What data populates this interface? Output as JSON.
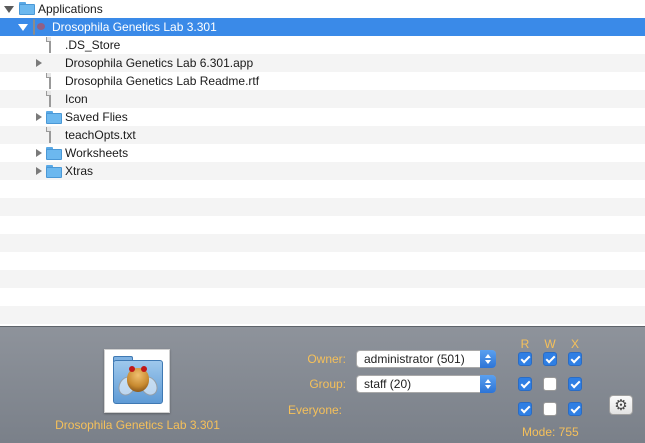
{
  "tree": {
    "root": {
      "label": "Applications",
      "icon": "folder-icon"
    },
    "selected": {
      "label": "Drosophila Genetics Lab 3.301",
      "icon": "package-icon"
    },
    "items": [
      {
        "label": ".DS_Store",
        "icon": "document-icon",
        "expandable": false
      },
      {
        "label": "Drosophila Genetics Lab 6.301.app",
        "icon": "globe-app-icon",
        "expandable": true
      },
      {
        "label": "Drosophila Genetics Lab Readme.rtf",
        "icon": "document-icon",
        "expandable": false
      },
      {
        "label": "Icon",
        "icon": "document-icon",
        "expandable": false
      },
      {
        "label": "Saved Flies",
        "icon": "folder-icon",
        "expandable": true
      },
      {
        "label": "teachOpts.txt",
        "icon": "document-icon",
        "expandable": false
      },
      {
        "label": "Worksheets",
        "icon": "folder-icon",
        "expandable": true
      },
      {
        "label": "Xtras",
        "icon": "folder-icon",
        "expandable": true
      }
    ]
  },
  "info": {
    "name": "Drosophila Genetics Lab 3.301",
    "owner_label": "Owner:",
    "owner_value": "administrator (501)",
    "group_label": "Group:",
    "group_value": "staff (20)",
    "everyone_label": "Everyone:",
    "headers": {
      "r": "R",
      "w": "W",
      "x": "X"
    },
    "permissions": {
      "owner": {
        "r": true,
        "w": true,
        "x": true
      },
      "group": {
        "r": true,
        "w": false,
        "x": true
      },
      "everyone": {
        "r": true,
        "w": false,
        "x": true
      }
    },
    "mode": "Mode: 755",
    "accent_color": "#f5c05a",
    "gear_icon": "gear-icon"
  }
}
